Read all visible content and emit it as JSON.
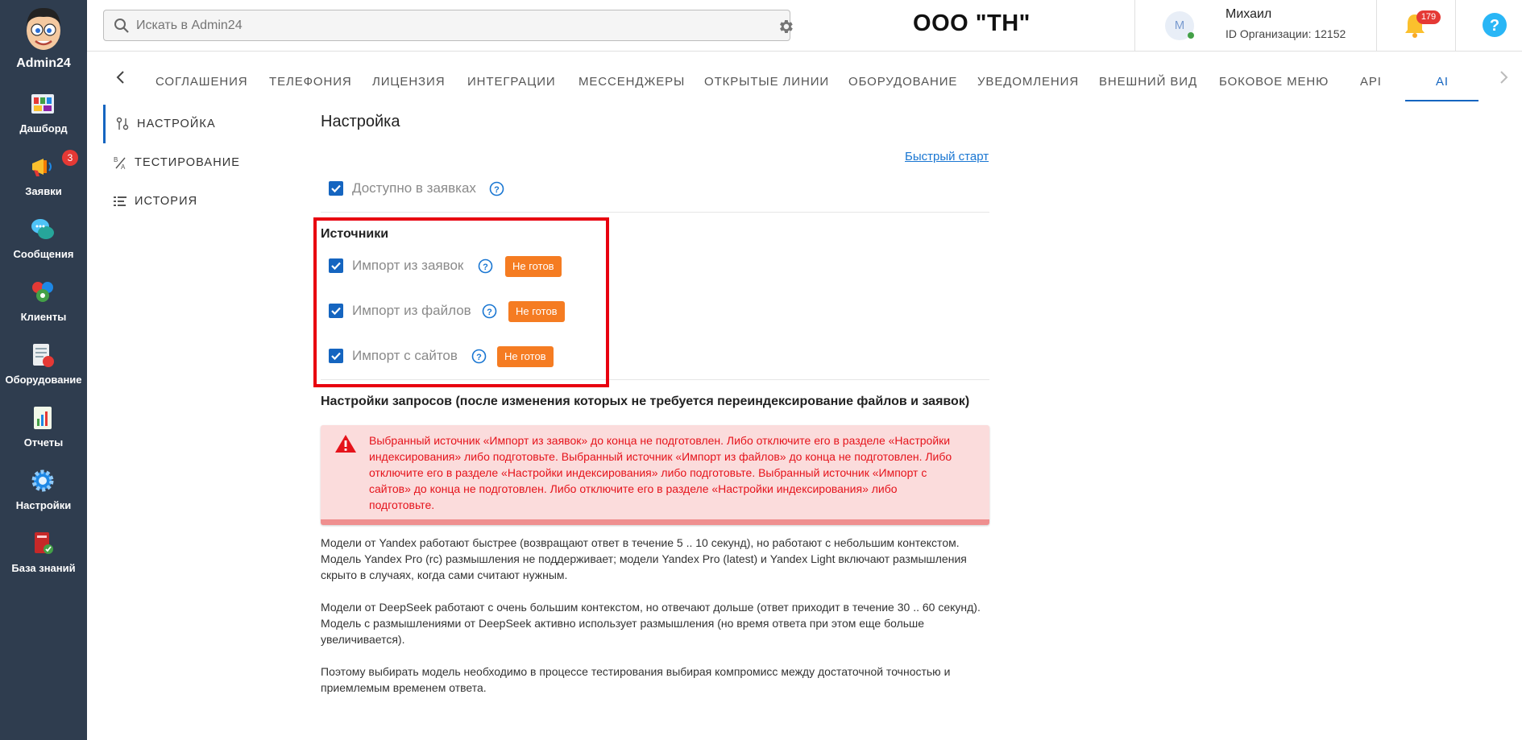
{
  "sidebar": {
    "brand": "Admin24",
    "items": [
      {
        "label": "Дашборд",
        "icon": "dashboard-icon"
      },
      {
        "label": "Заявки",
        "icon": "megaphone-icon",
        "badge": "3"
      },
      {
        "label": "Сообщения",
        "icon": "chat-bubbles-icon"
      },
      {
        "label": "Клиенты",
        "icon": "clients-icon"
      },
      {
        "label": "Оборудование",
        "icon": "equipment-icon"
      },
      {
        "label": "Отчеты",
        "icon": "reports-icon"
      },
      {
        "label": "Настройки",
        "icon": "gear-icon"
      },
      {
        "label": "База знаний",
        "icon": "knowledge-book-icon"
      }
    ]
  },
  "header": {
    "search_placeholder": "Искать в Admin24",
    "company": "ООО \"ТН\"",
    "user": {
      "initial": "М",
      "name": "Михаил",
      "org_id": "ID Организации: 12152"
    },
    "notifications": "179"
  },
  "tabs": {
    "items": [
      "СОГЛАШЕНИЯ",
      "ТЕЛЕФОНИЯ",
      "ЛИЦЕНЗИЯ",
      "ИНТЕГРАЦИИ",
      "МЕССЕНДЖЕРЫ",
      "ОТКРЫТЫЕ ЛИНИИ",
      "ОБОРУДОВАНИЕ",
      "УВЕДОМЛЕНИЯ",
      "ВНЕШНИЙ ВИД",
      "БОКОВОЕ МЕНЮ",
      "API",
      "AI"
    ],
    "active": "AI"
  },
  "submenu": {
    "items": [
      {
        "label": "НАСТРОЙКА",
        "icon": "settings-sliders-icon"
      },
      {
        "label": "ТЕСТИРОВАНИЕ",
        "icon": "percent-test-icon"
      },
      {
        "label": "ИСТОРИЯ",
        "icon": "list-history-icon"
      }
    ]
  },
  "main": {
    "title": "Настройка",
    "quick_start": "Быстрый старт",
    "available": "Доступно в заявках",
    "sources_title": "Источники",
    "sources": [
      {
        "label": "Импорт из заявок",
        "status": "Не готов",
        "checked": true
      },
      {
        "label": "Импорт из файлов",
        "status": "Не готов",
        "checked": true
      },
      {
        "label": "Импорт с сайтов",
        "status": "Не готов",
        "checked": true
      }
    ],
    "query_settings_title": "Настройки запросов (после изменения которых не требуется переиндексирование файлов и заявок)",
    "alert": "Выбранный источник «Импорт из заявок» до конца не подготовлен. Либо отключите его в разделе «Настройки индексирования» либо подготовьте. Выбранный источник «Импорт из файлов» до конца не подготовлен. Либо отключите его в разделе «Настройки индексирования» либо подготовьте. Выбранный источник «Импорт с сайтов» до конца не подготовлен. Либо отключите его в разделе «Настройки индексирования» либо подготовьте.",
    "info": [
      "Модели от Yandex работают быстрее (возвращают ответ в течение 5 .. 10 секунд), но работают с небольшим контекстом. Модель Yandex Pro (rc) размышления не поддерживает; модели Yandex Pro (latest) и Yandex Light включают размышления скрыто в случаях, когда сами считают нужным.",
      "Модели от DeepSeek работают с очень большим контекстом, но отвечают дольше (ответ приходит в течение 30 .. 60 секунд). Модель с размышлениями от DeepSeek активно использует размышления (но время ответа при этом еще больше увеличивается).",
      "Поэтому выбирать модель необходимо в процессе тестирования выбирая компромисс между достаточной точностью и приемлемым временем ответа."
    ]
  },
  "colors": {
    "sidebar": "#2f3d4f",
    "accent": "#1565c0",
    "badge_orange": "#f57c22",
    "alert_bg": "#fbdcdc",
    "alert_text": "#e5131b",
    "highlight_frame": "#e8000f"
  }
}
